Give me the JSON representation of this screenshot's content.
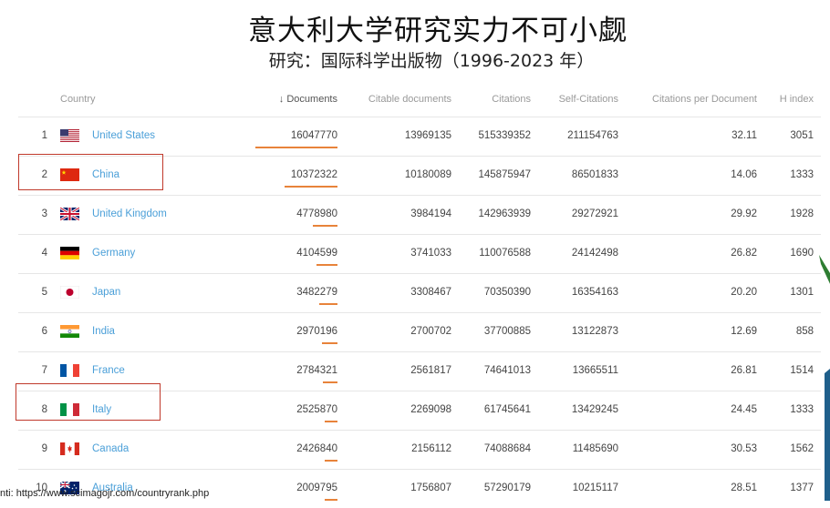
{
  "header": {
    "title": "意大利大学研究实力不可小觑",
    "subtitle": "研究：国际科学出版物（1996-2023 年）"
  },
  "table": {
    "columns": {
      "country": "Country",
      "documents": "↓ Documents",
      "citable": "Citable documents",
      "citations": "Citations",
      "self_citations": "Self-Citations",
      "cpd": "Citations per Document",
      "h_index": "H index"
    },
    "rows": [
      {
        "rank": "1",
        "flag": "us-flag-icon",
        "country": "United States",
        "documents": "16047770",
        "citable": "13969135",
        "citations": "515339352",
        "self_citations": "211154763",
        "cpd": "32.11",
        "h_index": "3051",
        "doc_share": 1.0
      },
      {
        "rank": "2",
        "flag": "cn-flag-icon",
        "country": "China",
        "documents": "10372322",
        "citable": "10180089",
        "citations": "145875947",
        "self_citations": "86501833",
        "cpd": "14.06",
        "h_index": "1333",
        "doc_share": 0.646
      },
      {
        "rank": "3",
        "flag": "gb-flag-icon",
        "country": "United Kingdom",
        "documents": "4778980",
        "citable": "3984194",
        "citations": "142963939",
        "self_citations": "29272921",
        "cpd": "29.92",
        "h_index": "1928",
        "doc_share": 0.298
      },
      {
        "rank": "4",
        "flag": "de-flag-icon",
        "country": "Germany",
        "documents": "4104599",
        "citable": "3741033",
        "citations": "110076588",
        "self_citations": "24142498",
        "cpd": "26.82",
        "h_index": "1690",
        "doc_share": 0.256
      },
      {
        "rank": "5",
        "flag": "jp-flag-icon",
        "country": "Japan",
        "documents": "3482279",
        "citable": "3308467",
        "citations": "70350390",
        "self_citations": "16354163",
        "cpd": "20.20",
        "h_index": "1301",
        "doc_share": 0.217
      },
      {
        "rank": "6",
        "flag": "in-flag-icon",
        "country": "India",
        "documents": "2970196",
        "citable": "2700702",
        "citations": "37700885",
        "self_citations": "13122873",
        "cpd": "12.69",
        "h_index": "858",
        "doc_share": 0.185
      },
      {
        "rank": "7",
        "flag": "fr-flag-icon",
        "country": "France",
        "documents": "2784321",
        "citable": "2561817",
        "citations": "74641013",
        "self_citations": "13665511",
        "cpd": "26.81",
        "h_index": "1514",
        "doc_share": 0.173
      },
      {
        "rank": "8",
        "flag": "it-flag-icon",
        "country": "Italy",
        "documents": "2525870",
        "citable": "2269098",
        "citations": "61745641",
        "self_citations": "13429245",
        "cpd": "24.45",
        "h_index": "1333",
        "doc_share": 0.157
      },
      {
        "rank": "9",
        "flag": "ca-flag-icon",
        "country": "Canada",
        "documents": "2426840",
        "citable": "2156112",
        "citations": "74088684",
        "self_citations": "11485690",
        "cpd": "30.53",
        "h_index": "1562",
        "doc_share": 0.151
      },
      {
        "rank": "10",
        "flag": "au-flag-icon",
        "country": "Australia",
        "documents": "2009795",
        "citable": "1756807",
        "citations": "57290179",
        "self_citations": "10215117",
        "cpd": "28.51",
        "h_index": "1377",
        "doc_share": 0.125
      }
    ],
    "highlighted": [
      "China",
      "Italy"
    ]
  },
  "footer": {
    "source": "nti: https://www.scimagojr.com/countryrank.php"
  },
  "colors": {
    "accent_bar": "#e8833a",
    "link": "#4a9fd8",
    "highlight_box": "#c0392b"
  }
}
